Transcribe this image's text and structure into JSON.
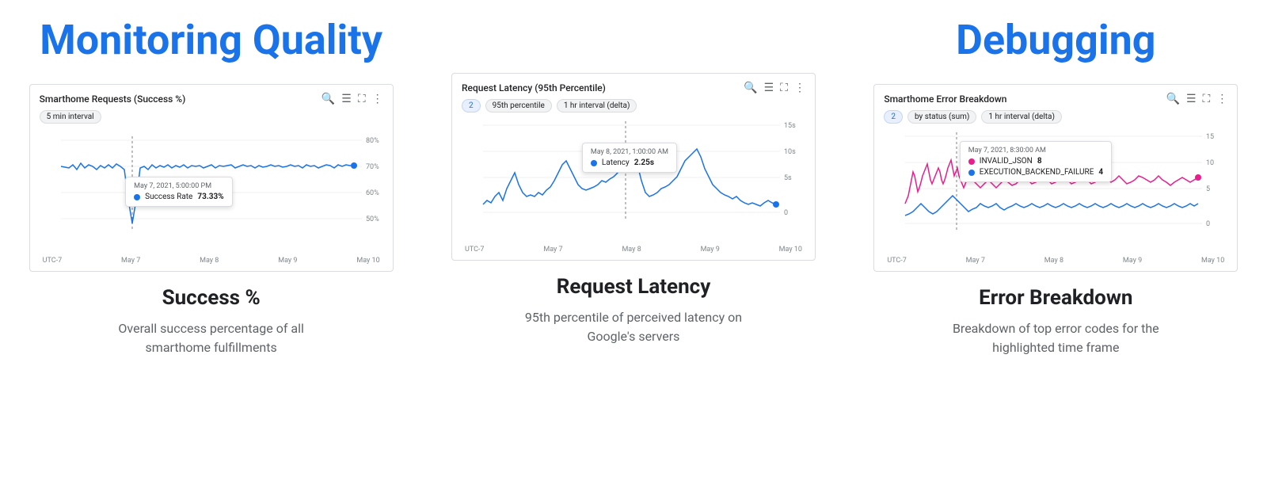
{
  "sections": [
    {
      "id": "monitoring",
      "title": "Monitoring Quality",
      "charts": [
        {
          "id": "success",
          "title": "Smarthome Requests (Success %)",
          "chips": [
            {
              "label": "5 min interval",
              "type": "plain"
            }
          ],
          "filter_count": null,
          "y_labels": [
            "80%",
            "70%",
            "60%",
            "50%"
          ],
          "x_labels": [
            "UTC-7",
            "May 7",
            "May 8",
            "May 9",
            "May 10"
          ],
          "tooltip": {
            "date": "May 7, 2021, 5:00:00 PM",
            "series": "Success Rate",
            "value": "73.33%",
            "dot_color": "#1a73e8"
          },
          "line_color": "#1a73e8",
          "chart_type": "success"
        },
        {
          "id": "latency",
          "title": "Request Latency (95th Percentile)",
          "chips": [
            {
              "label": "95th percentile",
              "type": "plain"
            },
            {
              "label": "1 hr interval (delta)",
              "type": "plain"
            }
          ],
          "filter_count": "2",
          "y_labels": [
            "15s",
            "10s",
            "5s",
            "0"
          ],
          "x_labels": [
            "UTC-7",
            "May 7",
            "May 8",
            "May 9",
            "May 10"
          ],
          "tooltip": {
            "date": "May 8, 2021, 1:00:00 AM",
            "series": "Latency",
            "value": "2.25s",
            "dot_color": "#1a73e8"
          },
          "line_color": "#1a73e8",
          "chart_type": "latency"
        }
      ],
      "metric_title": "Success %",
      "metric_desc": "Overall success percentage of all smarthome fulfillments",
      "metric2_title": "Request Latency",
      "metric2_desc": "95th percentile of perceived latency on Google's servers"
    }
  ],
  "debugging": {
    "title": "Debugging",
    "chart": {
      "id": "error",
      "title": "Smarthome Error Breakdown",
      "chips": [
        {
          "label": "by status (sum)",
          "type": "plain"
        },
        {
          "label": "1 hr interval (delta)",
          "type": "plain"
        }
      ],
      "filter_count": "2",
      "y_labels": [
        "15",
        "10",
        "5",
        "0"
      ],
      "x_labels": [
        "UTC-7",
        "May 7",
        "May 8",
        "May 9",
        "May 10"
      ],
      "tooltip": {
        "date": "May 7, 2021, 8:30:00 AM",
        "rows": [
          {
            "series": "INVALID_JSON",
            "value": "8",
            "dot_color": "#e91e8c"
          },
          {
            "series": "EXECUTION_BACKEND_FAILURE",
            "value": "4",
            "dot_color": "#1a73e8"
          }
        ]
      },
      "line_color": "#e91e8c",
      "line_color2": "#1a73e8",
      "chart_type": "error"
    },
    "metric_title": "Error Breakdown",
    "metric_desc": "Breakdown of top error codes for the highlighted time frame"
  },
  "icons": {
    "search": "🔍",
    "legend": "≡",
    "expand": "⤢",
    "more": "⋮",
    "filter": "▼"
  }
}
